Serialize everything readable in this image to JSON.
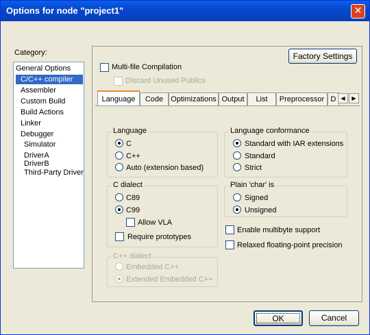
{
  "window": {
    "title": "Options for node \"project1\""
  },
  "category": {
    "label": "Category:",
    "items": [
      "General Options",
      "C/C++ compiler",
      "Assembler",
      "Custom Build",
      "Build Actions",
      "Linker",
      "Debugger",
      "Simulator",
      "DriverA",
      "DriverB",
      "Third-Party Driver"
    ],
    "selected": "C/C++ compiler"
  },
  "buttons": {
    "factory": "Factory Settings",
    "ok": "OK",
    "cancel": "Cancel"
  },
  "options": {
    "multifile": "Multi-file Compilation",
    "discard": "Discard Unused Publics"
  },
  "tabs": [
    "Language",
    "Code",
    "Optimizations",
    "Output",
    "List",
    "Preprocessor",
    "D"
  ],
  "active_tab": "Language",
  "language": {
    "group": "Language",
    "options": [
      "C",
      "C++",
      "Auto (extension based)"
    ],
    "selected": "C"
  },
  "conformance": {
    "group": "Language conformance",
    "options": [
      "Standard with IAR extensions",
      "Standard",
      "Strict"
    ],
    "selected": "Standard with IAR extensions"
  },
  "c_dialect": {
    "group": "C dialect",
    "options": [
      "C89",
      "C99"
    ],
    "selected": "C99",
    "allow_vla": "Allow VLA",
    "require_prototypes": "Require prototypes"
  },
  "plain_char": {
    "group": "Plain 'char' is",
    "options": [
      "Signed",
      "Unsigned"
    ],
    "selected": "Unsigned"
  },
  "extras": {
    "multibyte": "Enable multibyte support",
    "relaxed_fp": "Relaxed floating-point precision"
  },
  "cpp_dialect": {
    "group": "C++ dialect",
    "options": [
      "Embedded C++",
      "Extended Embedded C++"
    ],
    "selected": "Extended Embedded C++"
  }
}
